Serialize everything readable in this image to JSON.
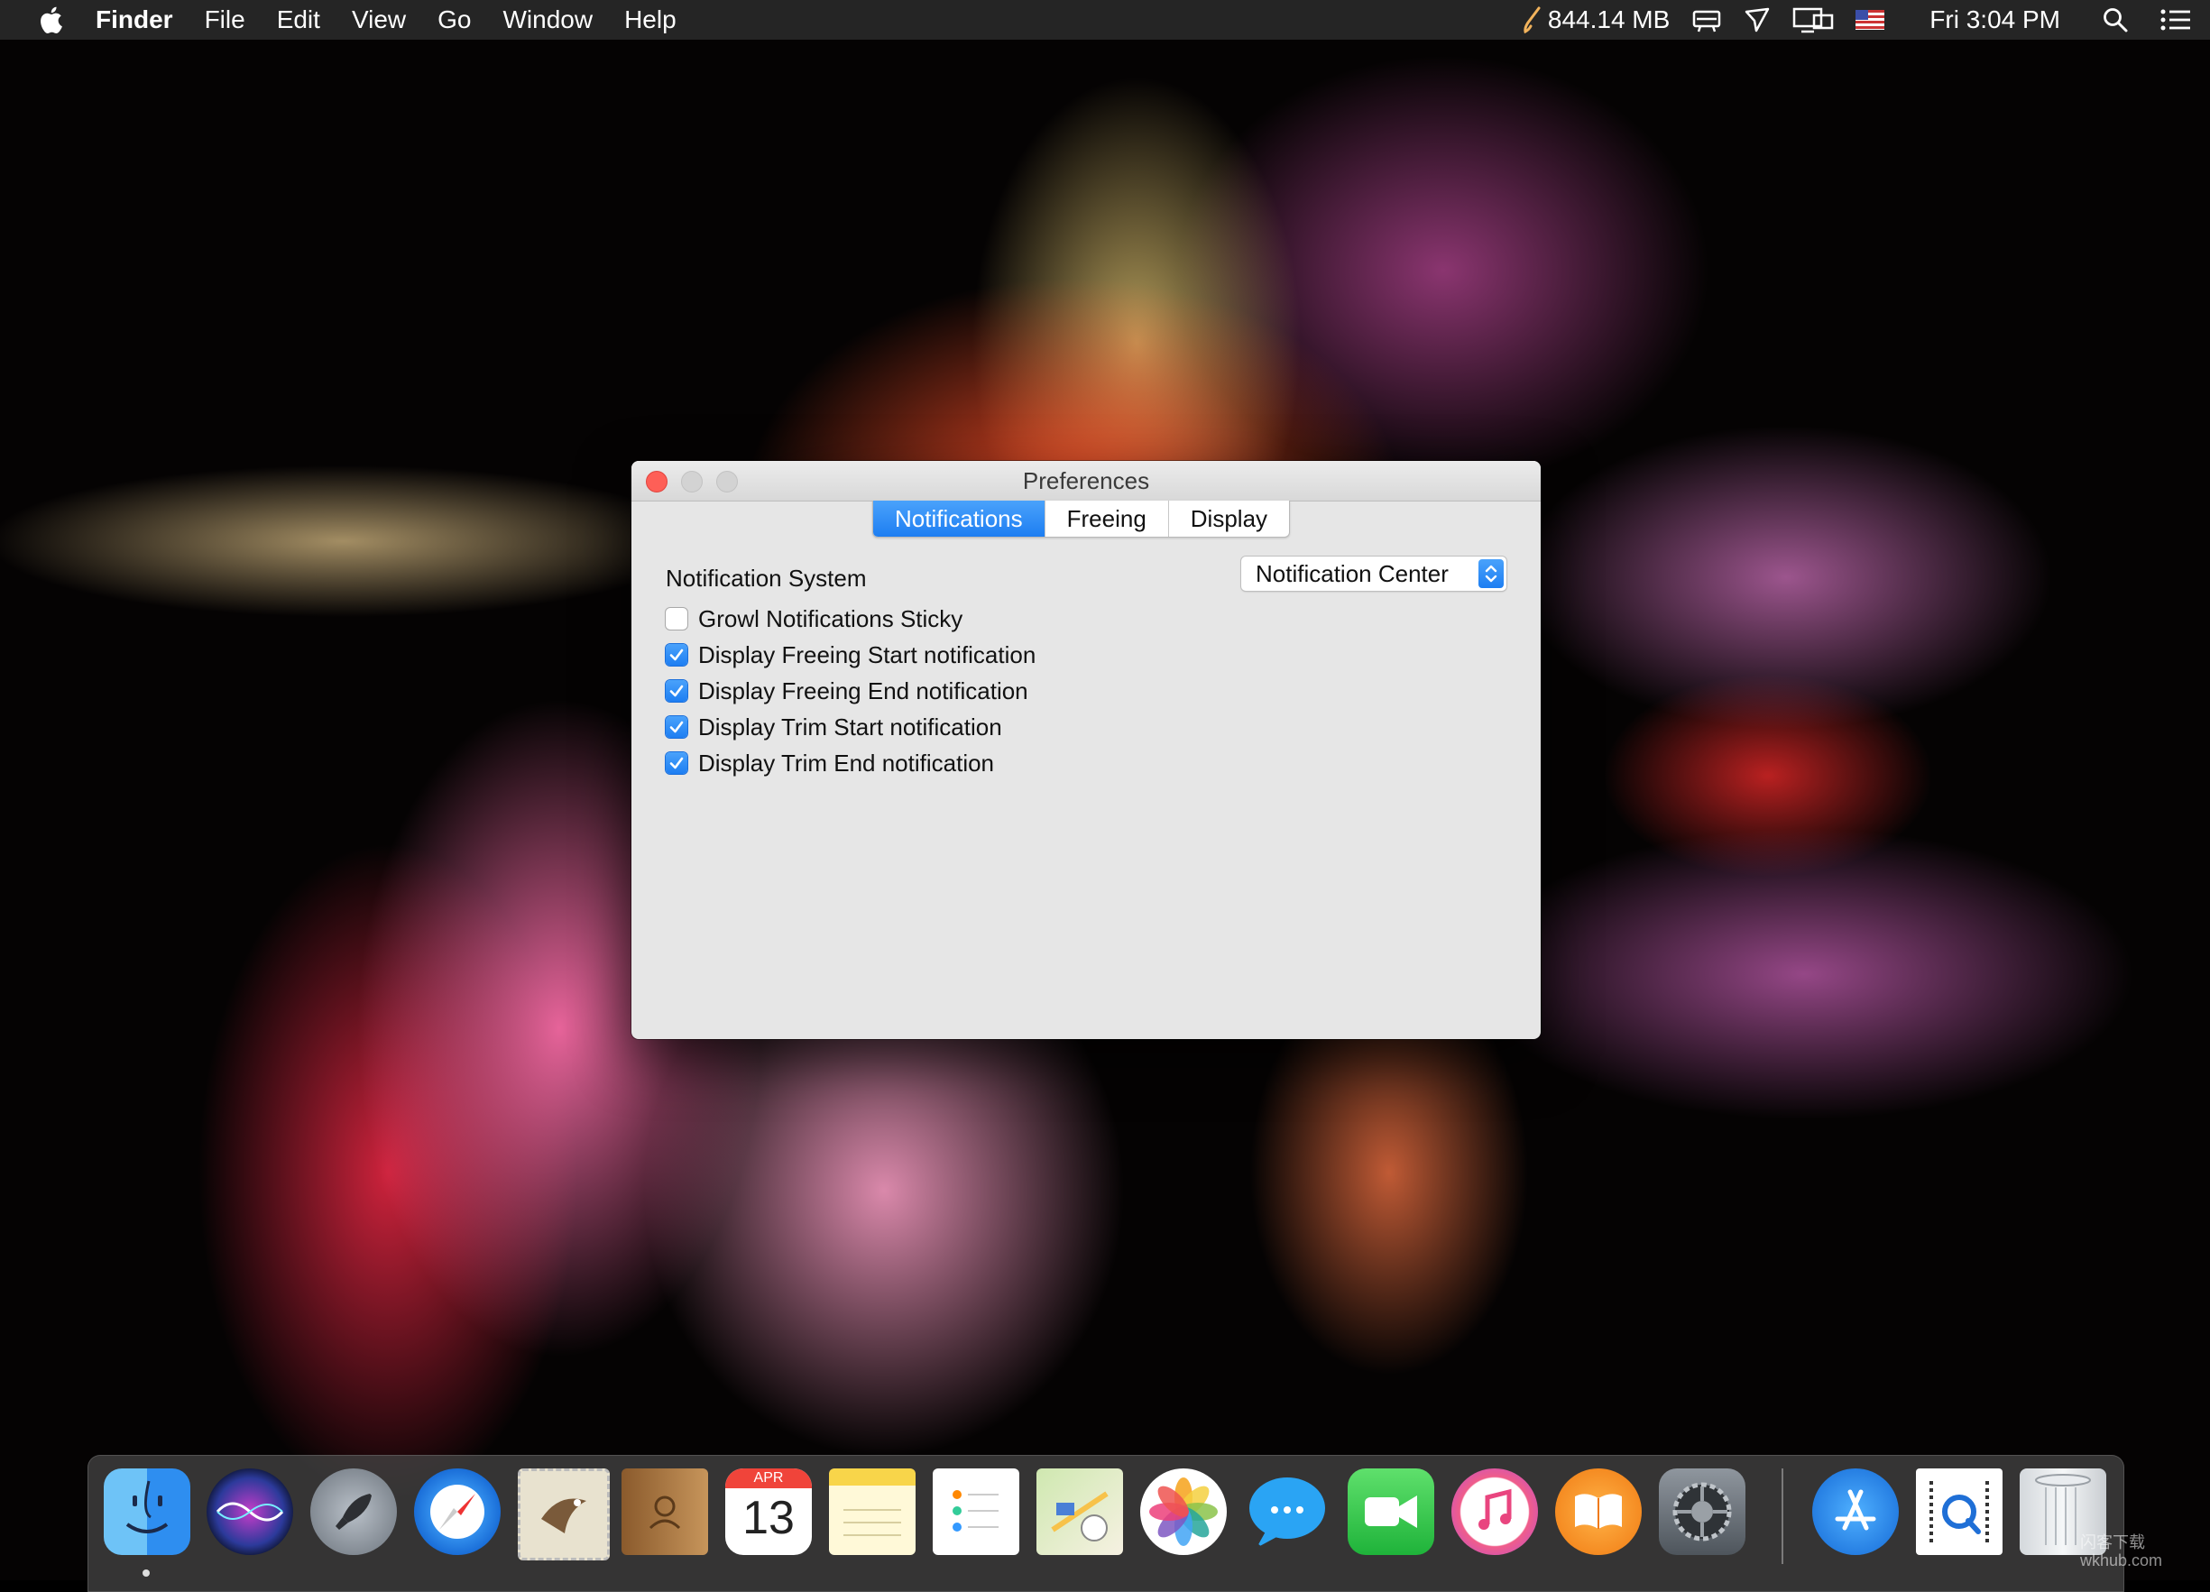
{
  "menubar": {
    "app_name": "Finder",
    "menus": [
      "File",
      "Edit",
      "View",
      "Go",
      "Window",
      "Help"
    ],
    "memory": "844.14 MB",
    "clock": "Fri 3:04 PM"
  },
  "window": {
    "title": "Preferences",
    "tabs": [
      {
        "label": "Notifications",
        "active": true
      },
      {
        "label": "Freeing",
        "active": false
      },
      {
        "label": "Display",
        "active": false
      }
    ],
    "notification_system": {
      "label": "Notification System",
      "selected": "Notification Center"
    },
    "options": [
      {
        "label": "Growl Notifications Sticky",
        "checked": false
      },
      {
        "label": "Display Freeing Start notification",
        "checked": true
      },
      {
        "label": "Display Freeing End notification",
        "checked": true
      },
      {
        "label": "Display Trim Start notification",
        "checked": true
      },
      {
        "label": "Display Trim End notification",
        "checked": true
      }
    ]
  },
  "dock": {
    "icons": [
      "finder-icon",
      "siri-icon",
      "launchpad-icon",
      "safari-icon",
      "mail-icon",
      "contacts-icon",
      "calendar-icon",
      "notes-icon",
      "reminders-icon",
      "maps-icon",
      "photos-icon",
      "messages-icon",
      "facetime-icon",
      "itunes-icon",
      "ibooks-icon",
      "system-preferences-icon",
      "app-store-icon",
      "quicktime-icon",
      "trash-icon"
    ],
    "calendar_month": "APR",
    "calendar_day": "13"
  },
  "watermark": {
    "line1": "闪客下载",
    "line2": "wkhub.com"
  },
  "colors": {
    "accent": "#1d7ef2",
    "close": "#fe5f57",
    "window_bg": "#e6e6e6"
  }
}
